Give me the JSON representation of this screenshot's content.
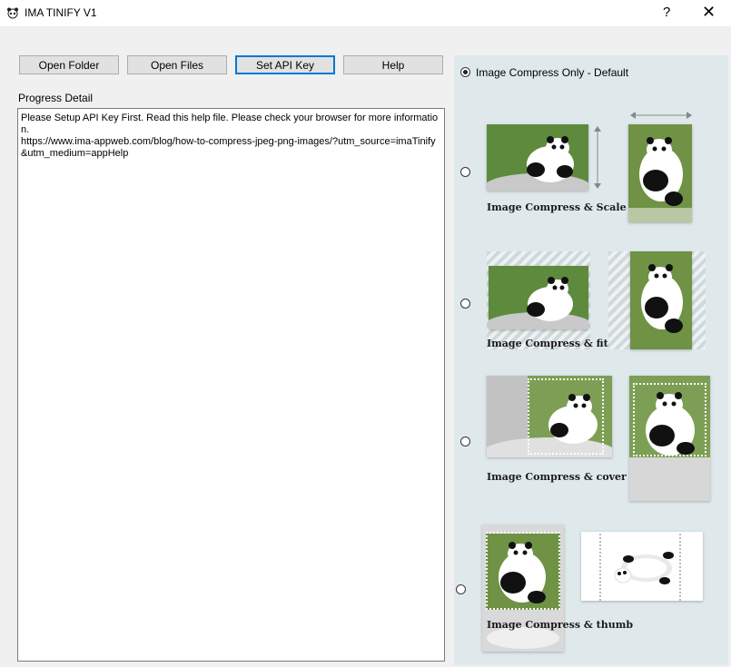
{
  "window": {
    "title": "IMA TINIFY V1",
    "help_glyph": "?",
    "close_glyph": "✕"
  },
  "toolbar": {
    "open_folder": "Open Folder",
    "open_files": "Open Files",
    "set_api_key": "Set API Key",
    "help": "Help"
  },
  "progress": {
    "label": "Progress Detail",
    "text": "Please Setup API Key First. Read this help file. Please check your browser for more information.\nhttps://www.ima-appweb.com/blog/how-to-compress-jpeg-png-images/?utm_source=imaTinify&utm_medium=appHelp"
  },
  "options": {
    "default_label": "Image Compress Only - Default",
    "scale_caption": "Image Compress & Scale",
    "fit_caption": "Image Compress & fit",
    "cover_caption": "Image Compress & cover",
    "thumb_caption": "Image Compress & thumb",
    "selected": "default"
  },
  "icons": [
    "panda-app-icon",
    "help-icon",
    "close-icon",
    "panda-image",
    "resize-arrow-icon"
  ]
}
